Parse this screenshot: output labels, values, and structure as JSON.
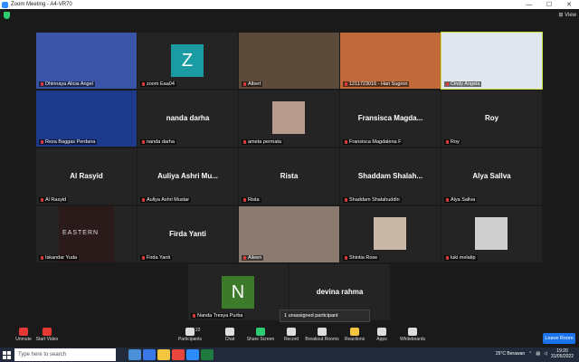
{
  "window": {
    "title": "Zoom Meeting - A4-VR70",
    "minimize": "—",
    "maximize": "☐",
    "close": "✕",
    "view_label": "⊞ View"
  },
  "participants": [
    {
      "name": "Dhinnaya Alicia Angel",
      "big": "",
      "video": true,
      "color": "#3a55a8"
    },
    {
      "name": "zoom Eaa04",
      "big": "",
      "video": false,
      "avatar_letter": "Z",
      "avatar_color": "#1b9ca3"
    },
    {
      "name": "Albert",
      "big": "",
      "video": true,
      "color": "#5c4a3a"
    },
    {
      "name": "1211723016 - Hari Sugron",
      "big": "",
      "video": true,
      "color": "#c0693a"
    },
    {
      "name": "Cindy Angela",
      "big": "",
      "video": true,
      "color": "#dfe6ee",
      "active": true
    },
    {
      "name": "Reza Baggas Perdana",
      "big": "",
      "video": true,
      "color": "#1d3a8a"
    },
    {
      "name": "nanda darha",
      "big": "nanda darha",
      "video": false
    },
    {
      "name": "ameta permata",
      "big": "",
      "video": true,
      "color": "#b89b8c",
      "small": true
    },
    {
      "name": "Fransisca Magdalena F",
      "big": "Fransisca Magda...",
      "video": false
    },
    {
      "name": "Roy",
      "big": "Roy",
      "video": false
    },
    {
      "name": "Al Rasyid",
      "big": "Al Rasyid",
      "video": false
    },
    {
      "name": "Auliya Ashri Mustar",
      "big": "Auliya Ashri Mu...",
      "video": false
    },
    {
      "name": "Rista",
      "big": "Rista",
      "video": false
    },
    {
      "name": "Shaddam Shalahuddin",
      "big": "Shaddam Shalah...",
      "video": false
    },
    {
      "name": "Alya Sallva",
      "big": "Alya Sallva",
      "video": false
    },
    {
      "name": "Iskandar Yuda",
      "big": "",
      "video": true,
      "color": "#2a1a1a",
      "logo_text": "EASTERN"
    },
    {
      "name": "Firda Yanti",
      "big": "Firda Yanti",
      "video": false
    },
    {
      "name": "Aileen",
      "big": "",
      "video": true,
      "color": "#8a7a70"
    },
    {
      "name": "Shintia Rose",
      "big": "",
      "video": true,
      "color": "#c9b7a8",
      "small": true
    },
    {
      "name": "luki melatip",
      "big": "",
      "video": true,
      "color": "#cfcfcf",
      "small": true
    },
    {
      "name": "Nanda Tresya Purba",
      "big": "",
      "video": false,
      "avatar_letter": "N",
      "avatar_color": "#3d7a2a"
    },
    {
      "name": "",
      "big": "devina rahma",
      "video": false
    }
  ],
  "popup_text": "1 unassigned participant",
  "toolbar": [
    {
      "label": "Unmute"
    },
    {
      "label": "Start Video"
    },
    {
      "label": "Participants",
      "badge": "22"
    },
    {
      "label": "Chat"
    },
    {
      "label": "Share Screen"
    },
    {
      "label": "Record"
    },
    {
      "label": "Breakout Rooms"
    },
    {
      "label": "Reactions"
    },
    {
      "label": "Apps"
    },
    {
      "label": "Whiteboards"
    }
  ],
  "leave_label": "Leave Room",
  "taskbar": {
    "search_placeholder": "Type here to search",
    "weather": "25°C  Berawan",
    "time": "19:20",
    "date": "31/05/2022"
  }
}
